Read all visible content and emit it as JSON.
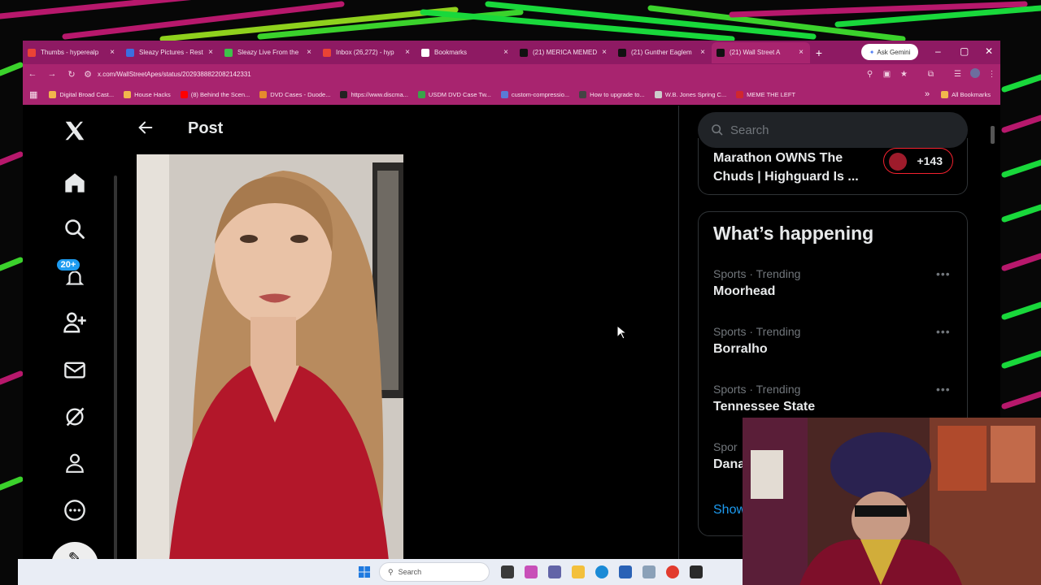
{
  "browser": {
    "tabs": [
      {
        "label": "Thumbs - hyperealp",
        "icon": "gmail-icon"
      },
      {
        "label": "Sleazy Pictures - Rest",
        "icon": "bookmark-app-icon"
      },
      {
        "label": "Sleazy Live From the",
        "icon": "play-icon"
      },
      {
        "label": "Inbox (26,272) - hyp",
        "icon": "gmail-icon"
      },
      {
        "label": "Bookmarks",
        "icon": "star-icon"
      },
      {
        "label": "(21) MERICA MEMED",
        "icon": "x-logo-icon"
      },
      {
        "label": "(21) Gunther Eaglem",
        "icon": "x-logo-icon"
      },
      {
        "label": "(21) Wall Street A",
        "icon": "x-logo-icon",
        "active": true
      }
    ],
    "ask_gemini": "Ask Gemini",
    "url": "x.com/WallStreetApes/status/2029388822082142331",
    "bookmarks": [
      {
        "label": "Digital Broad Cast...",
        "color": "#f2b64c"
      },
      {
        "label": "House Hacks",
        "color": "#f2b64c"
      },
      {
        "label": "(8) Behind the Scen...",
        "color": "#ff0000"
      },
      {
        "label": "DVD Cases - Duode...",
        "color": "#e58a2c"
      },
      {
        "label": "https://www.discma...",
        "color": "#222222"
      },
      {
        "label": "USDM DVD Case Tw...",
        "color": "#3aa34a"
      },
      {
        "label": "custom-compressio...",
        "color": "#5a7bd6"
      },
      {
        "label": "How to upgrade to...",
        "color": "#444444"
      },
      {
        "label": "W.B. Jones Spring C...",
        "color": "#cccccc"
      },
      {
        "label": "MEME THE LEFT",
        "color": "#d0272f"
      }
    ],
    "all_bookmarks": "All Bookmarks"
  },
  "nav": {
    "notifications_badge": "20+"
  },
  "main": {
    "title": "Post"
  },
  "sidebar": {
    "search_placeholder": "Search",
    "promo": {
      "text": "Marathon OWNS The Chuds | Highguard Is ...",
      "count": "+143"
    },
    "happening_title": "What’s happening",
    "trends": [
      {
        "meta": "Sports · Trending",
        "name": "Moorhead"
      },
      {
        "meta": "Sports · Trending",
        "name": "Borralho"
      },
      {
        "meta": "Sports · Trending",
        "name": "Tennessee State"
      },
      {
        "meta": "Spor",
        "name": "Dana"
      }
    ],
    "show_more": "Show"
  },
  "taskbar": {
    "search_label": "Search"
  },
  "colors": {
    "browser_chrome": "#a8246f",
    "x_accent": "#1d9bf0",
    "promo_border": "#f4212e"
  }
}
